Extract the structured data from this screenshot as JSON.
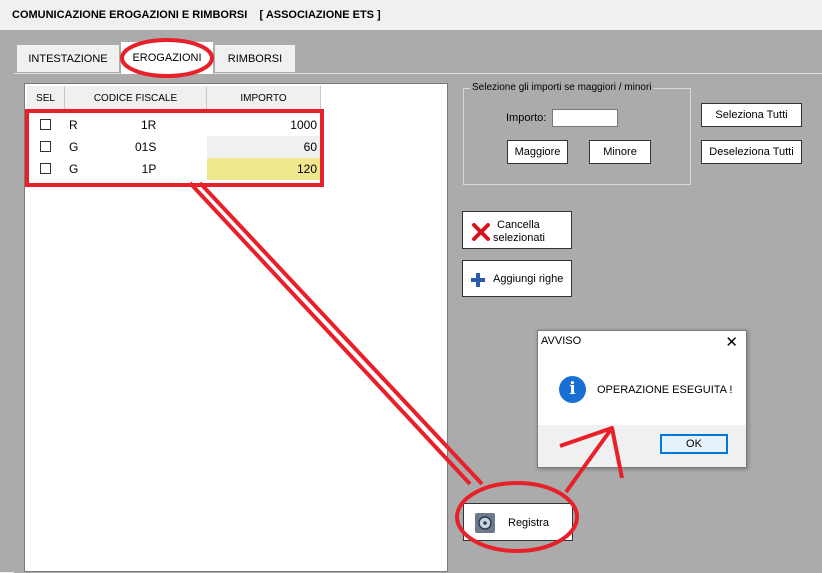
{
  "window": {
    "title": "COMUNICAZIONE EROGAZIONI E RIMBORSI    [ ASSOCIAZIONE ETS ]"
  },
  "tabs": [
    {
      "label": "INTESTAZIONE",
      "active": false
    },
    {
      "label": "EROGAZIONI",
      "active": true
    },
    {
      "label": "RIMBORSI",
      "active": false
    }
  ],
  "grid": {
    "headers": {
      "sel": "SEL",
      "cf": "CODICE FISCALE",
      "importo": "IMPORTO"
    },
    "rows": [
      {
        "selected": false,
        "codice_fiscale": "R                   1R",
        "importo": "1000",
        "highlight": false
      },
      {
        "selected": false,
        "codice_fiscale": "G                 01S",
        "importo": "60",
        "highlight": false
      },
      {
        "selected": false,
        "codice_fiscale": "G                   1P",
        "importo": "120",
        "highlight": true
      }
    ]
  },
  "selection": {
    "legend": "Selezione gli importi se maggiori / minori",
    "importo_label": "Importo:",
    "importo_value": "",
    "maggiore_label": "Maggiore",
    "minore_label": "Minore"
  },
  "buttons": {
    "seleziona_tutti": "Seleziona Tutti",
    "deseleziona_tutti": "Deseleziona Tutti",
    "cancella_line1": "Cancella",
    "cancella_line2": "selezionati",
    "aggiungi": "Aggiungi righe",
    "registra": "Registra"
  },
  "dialog": {
    "title": "AVVISO",
    "message": "OPERAZIONE ESEGUITA !",
    "ok_label": "OK",
    "close_glyph": "✕"
  },
  "colors": {
    "annotation": "#e8202a",
    "highlight_cell": "#f0e68c",
    "info_blue": "#1a6fd4",
    "form_background": "#ababab"
  }
}
